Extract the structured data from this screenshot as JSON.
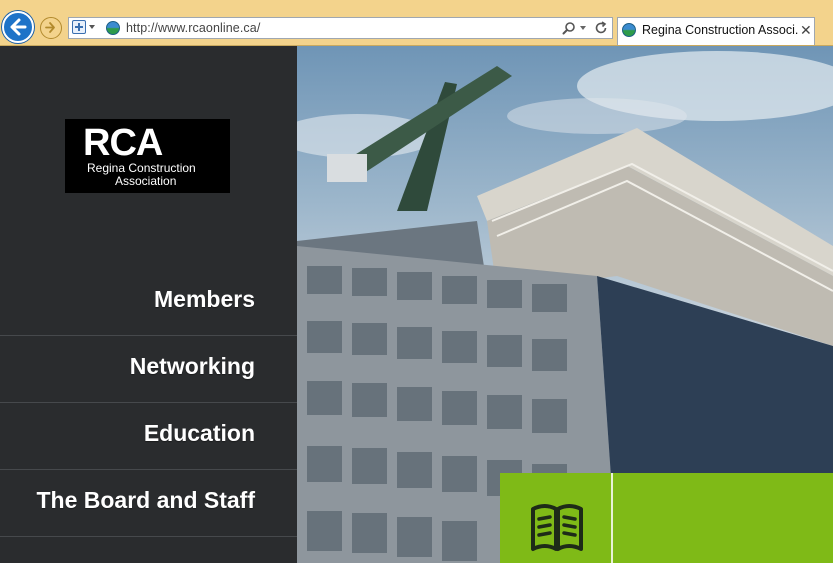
{
  "browser": {
    "url": "http://www.rcaonline.ca/",
    "tab_title": "Regina Construction Associ...",
    "tab_close": "✕"
  },
  "logo": {
    "acronym": "RCA",
    "line1": "Regina Construction",
    "line2": "Association"
  },
  "nav": {
    "items": [
      {
        "label": "Members"
      },
      {
        "label": "Networking"
      },
      {
        "label": "Education"
      },
      {
        "label": "The Board and Staff"
      }
    ]
  },
  "feature": {
    "icon": "book-icon"
  },
  "colors": {
    "nav_bg": "#2a2c2e",
    "accent_green": "#7fba17",
    "chrome_bg": "#f3d38c"
  }
}
